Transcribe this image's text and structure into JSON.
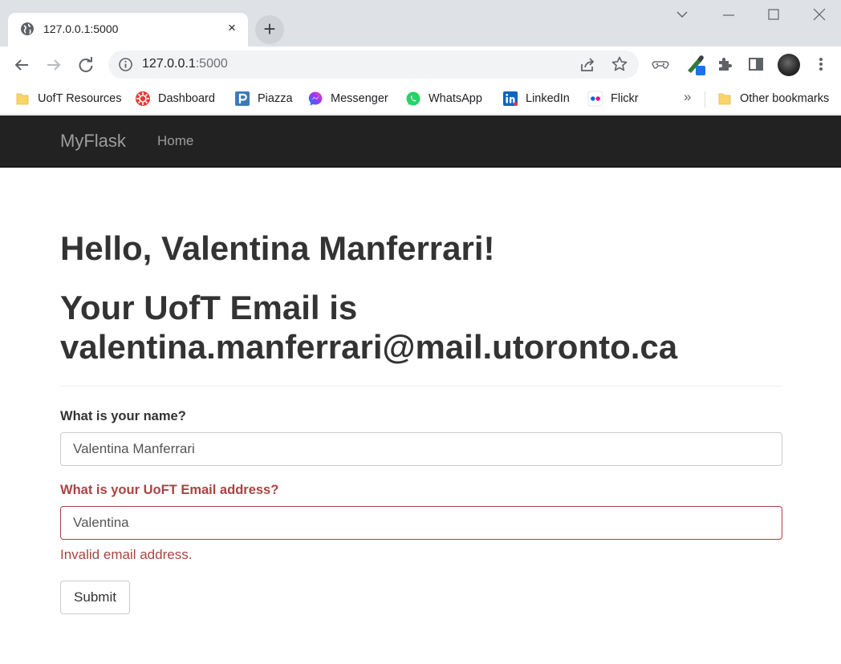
{
  "browser": {
    "tab": {
      "title": "127.0.0.1:5000",
      "close_glyph": "×",
      "favicon": "globe-icon"
    },
    "new_tab_glyph": "+",
    "address": {
      "host": "127.0.0.1",
      "port": ":5000"
    },
    "bookmarks": [
      {
        "label": "UofT Resources",
        "icon": "folder-icon",
        "color": "#f9d46b"
      },
      {
        "label": "Dashboard",
        "icon": "dashboard-icon",
        "color": "#e53935"
      },
      {
        "label": "Piazza",
        "icon": "piazza-icon",
        "color": "#3e7ab8"
      },
      {
        "label": "Messenger",
        "icon": "messenger-icon",
        "color": "#a334fa"
      },
      {
        "label": "WhatsApp",
        "icon": "whatsapp-icon",
        "color": "#25d366"
      },
      {
        "label": "LinkedIn",
        "icon": "linkedin-icon",
        "color": "#0a66c2"
      },
      {
        "label": "Flickr",
        "icon": "flickr-icon",
        "color": "#ff0084"
      },
      {
        "label": "Other bookmarks",
        "icon": "folder-icon",
        "color": "#f9d46b"
      }
    ],
    "bookmarks_overflow": "»"
  },
  "navbar": {
    "brand": "MyFlask",
    "home": "Home"
  },
  "page": {
    "greeting": "Hello, Valentina Manferrari!",
    "email_heading": "Your UofT Email is valentina.manferrari@mail.utoronto.ca",
    "form": {
      "name_label": "What is your name?",
      "name_value": "Valentina Manferrari",
      "email_label": "What is your UoFT Email address?",
      "email_value": "Valentina",
      "email_error": "Invalid email address.",
      "submit_label": "Submit"
    }
  },
  "colors": {
    "navbar_bg": "#222222",
    "error": "#a94442",
    "text": "#333333"
  }
}
